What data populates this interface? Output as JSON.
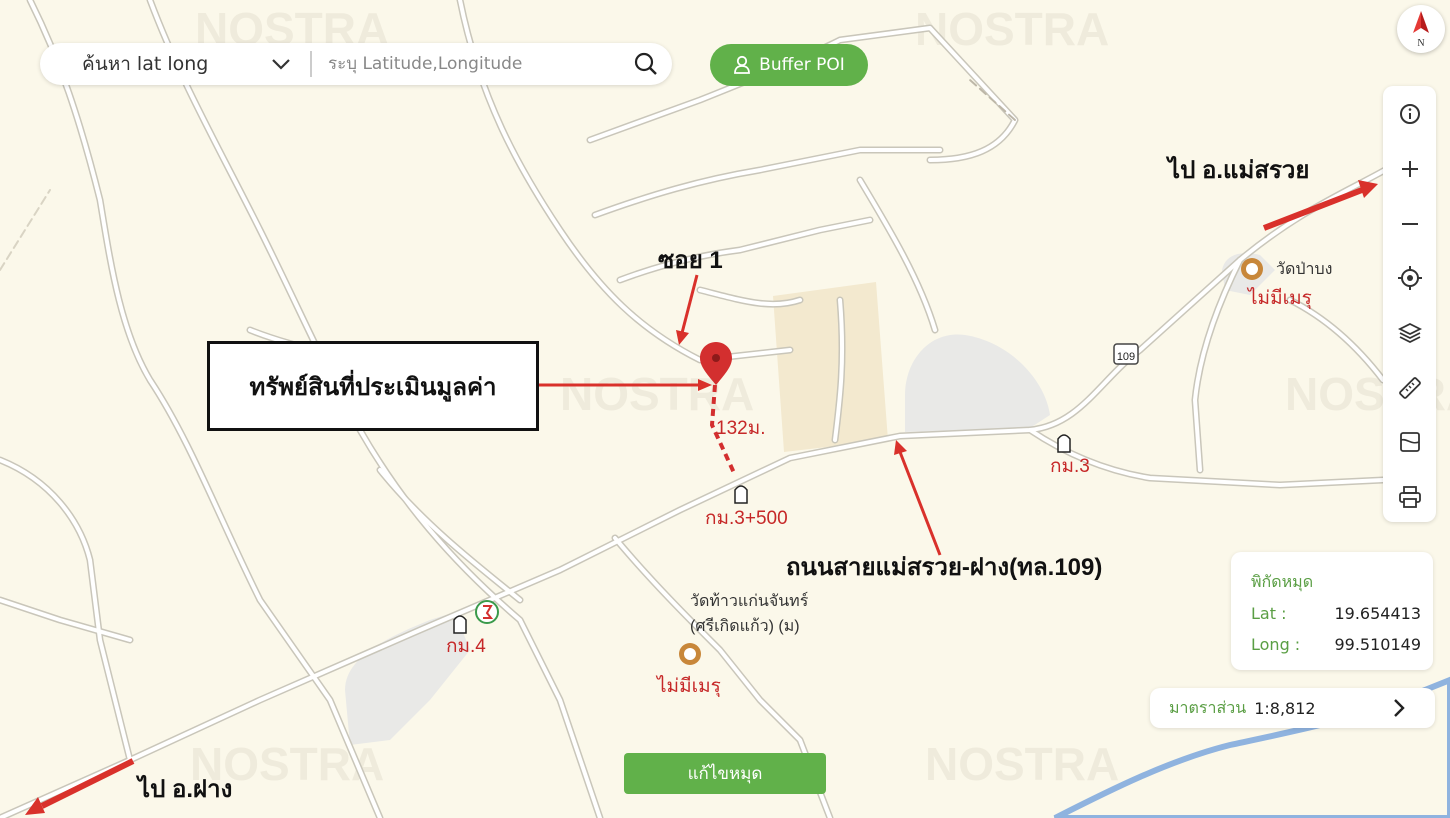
{
  "search": {
    "type_label": "ค้นหา lat long",
    "placeholder": "ระบุ Latitude,Longitude"
  },
  "buffer_button": "Buffer POI",
  "compass_label": "N",
  "toolbar": [
    "info-icon",
    "zoom-in-icon",
    "zoom-out-icon",
    "locate-icon",
    "layers-icon",
    "ruler-icon",
    "map-mode-icon",
    "print-icon"
  ],
  "coords": {
    "title": "พิกัดหมุด",
    "lat_label": "Lat :",
    "lat_value": "19.654413",
    "long_label": "Long :",
    "long_value": "99.510149"
  },
  "scale": {
    "label": "มาตราส่วน",
    "value": "1:8,812"
  },
  "edit_button": "แก้ไขหมุด",
  "annotations": {
    "property": "ทรัพย์สินที่ประเมินมูลค่า",
    "soi": "ซอย 1",
    "distance": "132ม.",
    "road": "ถนนสายแม่สรวย-ฝาง(ทล.109)",
    "to_mae_suai": "ไป อ.แม่สรวย",
    "to_fang": "ไป อ.ฝาง"
  },
  "map_labels": {
    "km_3_500": "กม.3+500",
    "km_3": "กม.3",
    "km_4": "กม.4",
    "road_shield": "109",
    "temple_1_name": "วัดป่าบง",
    "temple_1_status": "ไม่มีเมรุ",
    "temple_2_name_line1": "วัดท้าวแก่นจันทร์",
    "temple_2_name_line2": "(ศรีเกิดแก้ว) (ม)",
    "temple_2_status": "ไม่มีเมรุ",
    "watermark": "NOSTRA"
  },
  "colors": {
    "accent_green": "#61b14a",
    "label_green": "#5a9e44",
    "annotation_red": "#d9312b",
    "map_bg": "#fbf8ea",
    "marker_red": "#d32f2f"
  }
}
